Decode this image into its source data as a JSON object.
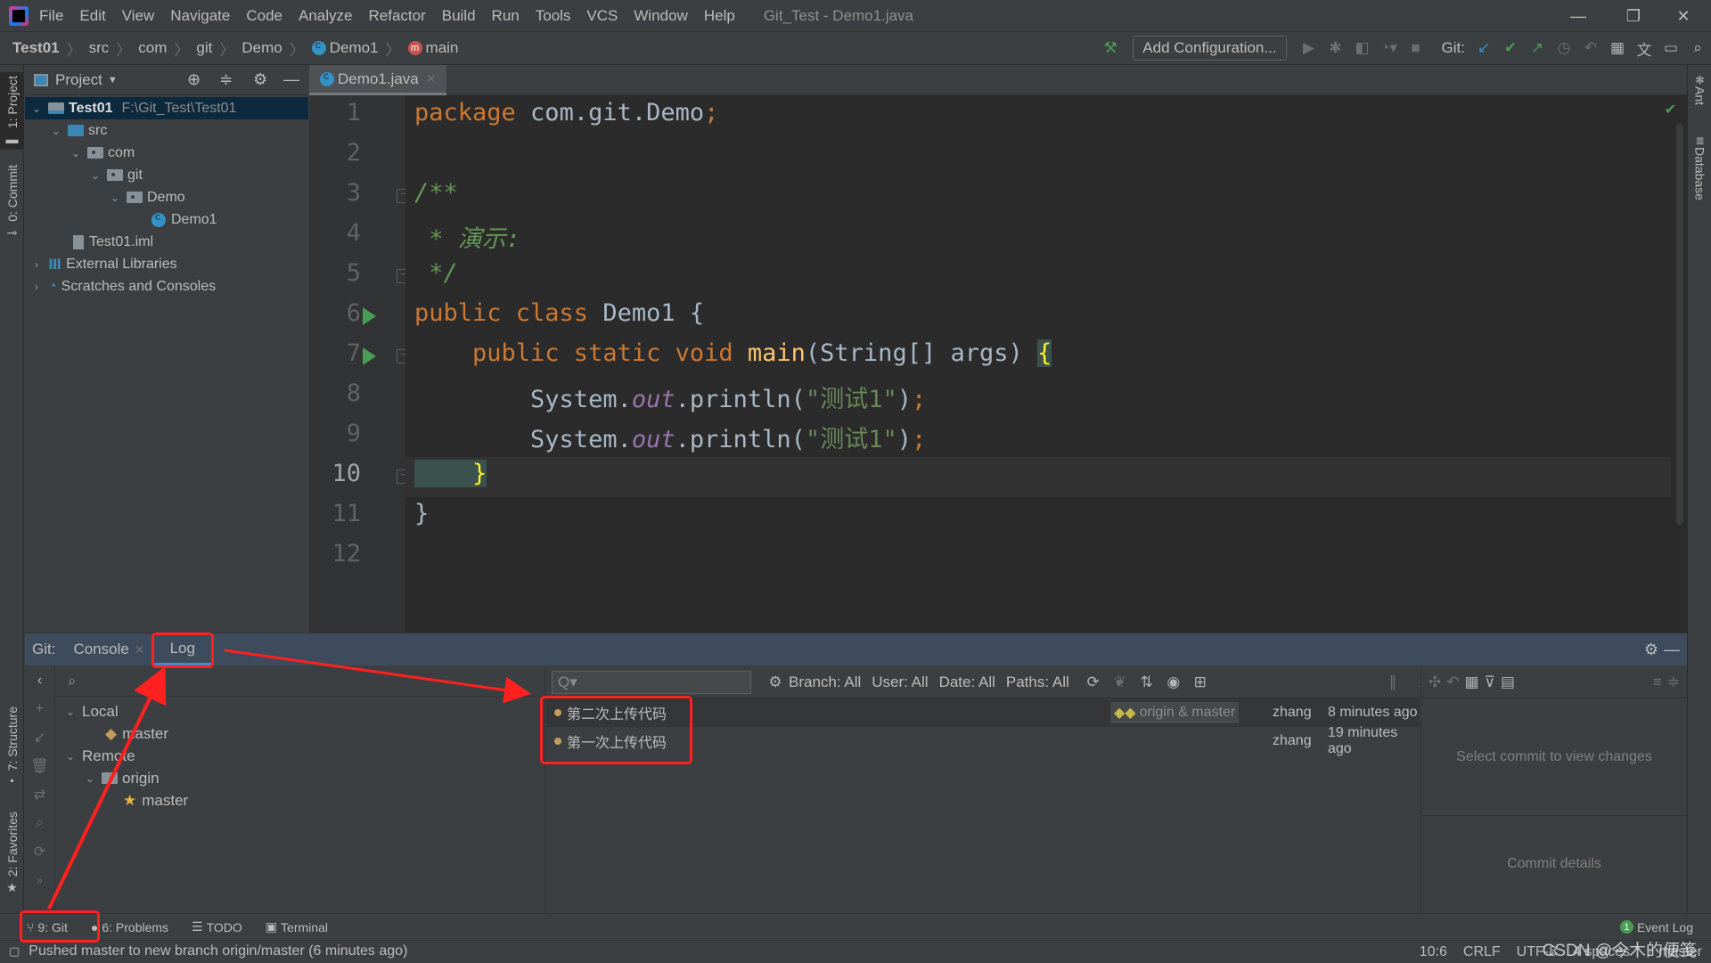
{
  "window": {
    "title": "Git_Test - Demo1.java",
    "menu": [
      "File",
      "Edit",
      "View",
      "Navigate",
      "Code",
      "Analyze",
      "Refactor",
      "Build",
      "Run",
      "Tools",
      "VCS",
      "Window",
      "Help"
    ],
    "controls": {
      "minimize": "—",
      "restore": "❐",
      "close": "✕"
    }
  },
  "navbar": {
    "breadcrumbs": [
      "Test01",
      "src",
      "com",
      "git",
      "Demo",
      "Demo1",
      "main"
    ],
    "add_configuration": "Add Configuration...",
    "git_label": "Git:"
  },
  "left_strip": {
    "project_tab": "1: Project",
    "commit_tab": "0: Commit",
    "structure_tab": "7: Structure",
    "favorites_tab": "2: Favorites"
  },
  "right_strip": {
    "ant_tab": "Ant",
    "database_tab": "Database"
  },
  "project_panel": {
    "title": "Project",
    "tree": [
      {
        "label": "Test01",
        "path": "F:\\Git_Test\\Test01",
        "level": 0,
        "type": "module",
        "expanded": true,
        "selected": true
      },
      {
        "label": "src",
        "level": 1,
        "type": "src-folder",
        "expanded": true
      },
      {
        "label": "com",
        "level": 2,
        "type": "package",
        "expanded": true
      },
      {
        "label": "git",
        "level": 3,
        "type": "package",
        "expanded": true
      },
      {
        "label": "Demo",
        "level": 4,
        "type": "package",
        "expanded": true
      },
      {
        "label": "Demo1",
        "level": 5,
        "type": "class"
      },
      {
        "label": "Test01.iml",
        "level": 1,
        "type": "file"
      },
      {
        "label": "External Libraries",
        "level": 0,
        "type": "library",
        "expanded": false
      },
      {
        "label": "Scratches and Consoles",
        "level": 0,
        "type": "scratches",
        "expanded": false
      }
    ]
  },
  "editor": {
    "tab": "Demo1.java",
    "current_line": 10,
    "line_numbers": [
      "1",
      "2",
      "3",
      "4",
      "5",
      "6",
      "7",
      "8",
      "9",
      "10",
      "11",
      "12"
    ],
    "lines": {
      "l1_kw": "package",
      "l1_rest": " com.git.Demo",
      "l1_semi": ";",
      "l3": "/**",
      "l4": " * 演示:",
      "l5": " */",
      "l6_kw": "public class",
      "l6_rest": " Demo1 {",
      "l7_kw": "    public static void",
      "l7_fn": " main",
      "l7_rest": "(String[] args) ",
      "l7_brace": "{",
      "l8_a": "        System.",
      "l8_fld": "out",
      "l8_b": ".println(",
      "l8_str": "\"测试1\"",
      "l8_c": ")",
      "l8_semi": ";",
      "l9_a": "        System.",
      "l9_fld": "out",
      "l9_b": ".println(",
      "l9_str": "\"测试1\"",
      "l9_c": ")",
      "l9_semi": ";",
      "l10": "    }",
      "l11": "}"
    }
  },
  "git_panel": {
    "prefix": "Git:",
    "tabs": [
      {
        "label": "Console",
        "closable": true
      },
      {
        "label": "Log",
        "active": true
      }
    ],
    "branches": {
      "local_label": "Local",
      "local": [
        "master"
      ],
      "remote_label": "Remote",
      "remote_group": "origin",
      "remote": [
        "master"
      ]
    },
    "log_toolbar": {
      "search_placeholder": "Q▾",
      "filters": [
        "Branch: All",
        "User: All",
        "Date: All",
        "Paths: All"
      ]
    },
    "commits": [
      {
        "message": "第二次上传代码",
        "refs": "origin & master",
        "author": "zhang",
        "time": "8 minutes ago"
      },
      {
        "message": "第一次上传代码",
        "refs": "",
        "author": "zhang",
        "time": "19 minutes ago"
      }
    ],
    "details": {
      "changes_placeholder": "Select commit to view changes",
      "details_placeholder": "Commit details"
    }
  },
  "bottom_tabs": [
    "9: Git",
    "6: Problems",
    "TODO",
    "Terminal"
  ],
  "event_log": {
    "label": "Event Log",
    "count": "1"
  },
  "statusbar": {
    "message": "Pushed master to new branch origin/master (6 minutes ago)",
    "position": "10:6",
    "line_sep": "CRLF",
    "encoding": "UTF-8",
    "indent": "4 spaces",
    "branch": "master",
    "watermark": "CSDN @今木的便笺"
  },
  "colors": {
    "annotation": "#ff2020",
    "accent": "#4a88c7",
    "run": "#499c54"
  }
}
